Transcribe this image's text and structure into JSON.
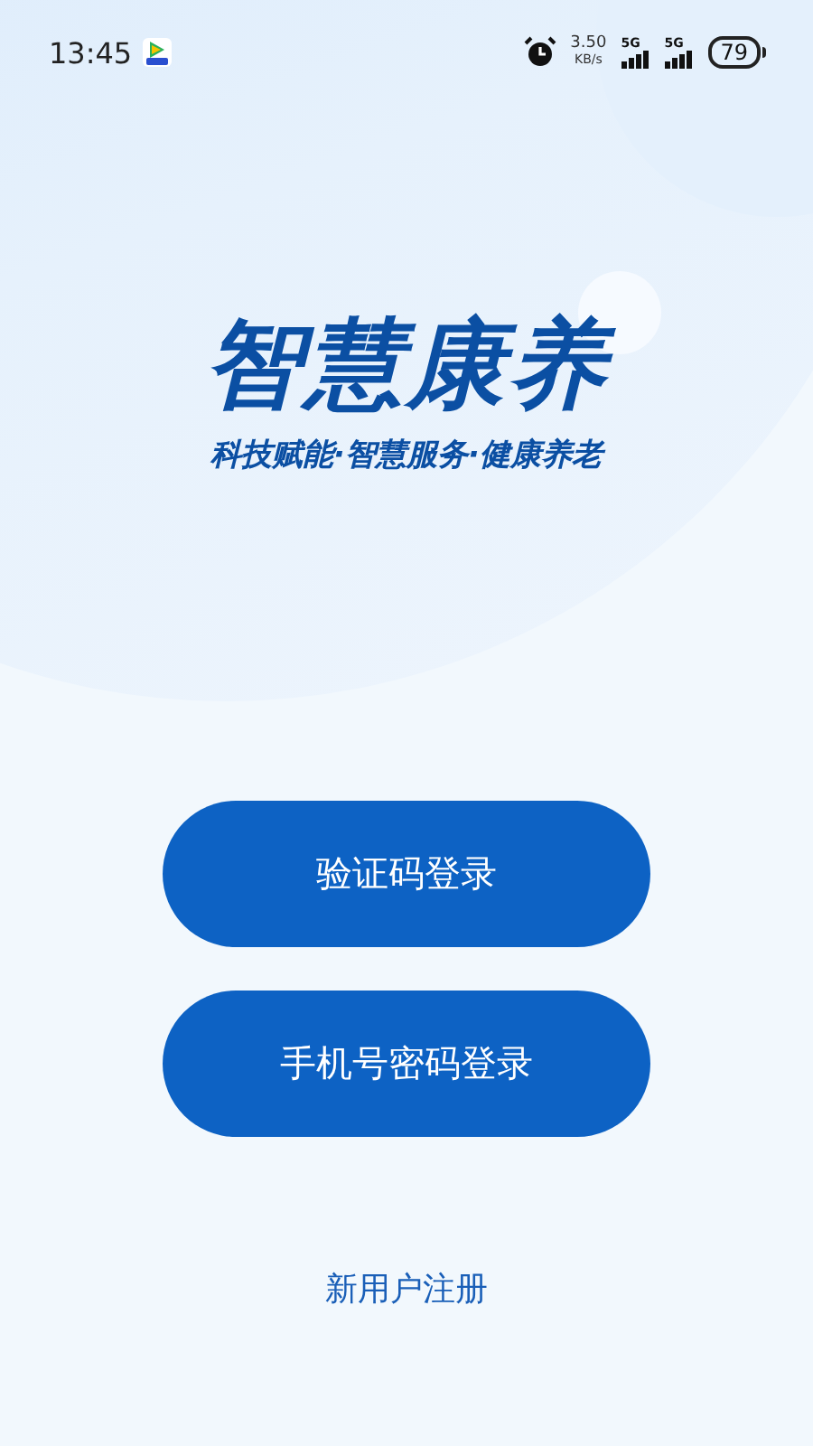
{
  "status_bar": {
    "time": "13:45",
    "speed_value": "3.50",
    "speed_unit": "KB/s",
    "networks": [
      "5G",
      "5G"
    ],
    "battery": "79"
  },
  "brand": {
    "title": "智慧康养",
    "slogan": "科技赋能·智慧服务·健康养老"
  },
  "buttons": [
    "验证码登录",
    "手机号密码登录"
  ],
  "register_link": "新用户注册"
}
